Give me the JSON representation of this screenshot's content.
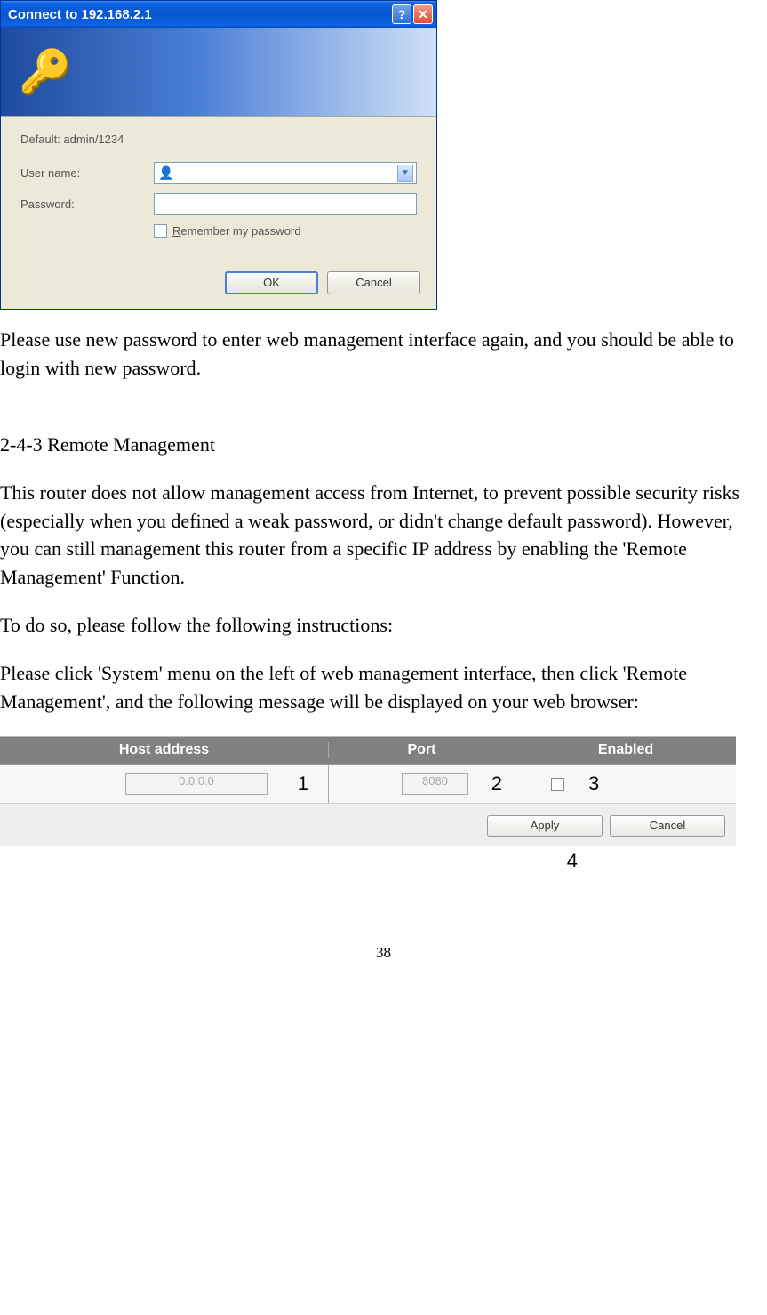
{
  "dialog": {
    "title": "Connect to 192.168.2.1",
    "help_symbol": "?",
    "close_symbol": "✕",
    "default_hint": "Default: admin/1234",
    "username_label": "User name:",
    "password_label": "Password:",
    "remember_prefix": "R",
    "remember_rest": "emember my password",
    "ok_label": "OK",
    "cancel_label": "Cancel"
  },
  "text": {
    "p1": "Please use new password to enter web management interface again, and you should be able to login with new password.",
    "h1": "2-4-3 Remote Management",
    "p2": "This router does not allow management access from Internet, to prevent possible security risks (especially when you defined a weak password, or didn't change default password). However, you can still management this router from a specific IP address by enabling the 'Remote Management' Function.",
    "p3": "To do so, please follow the following instructions:",
    "p4": "Please click 'System' menu on the left of web management interface, then click 'Remote Management', and the following message will be displayed on your web browser:"
  },
  "rm": {
    "headers": {
      "host": "Host address",
      "port": "Port",
      "enabled": "Enabled"
    },
    "host_value": "0.0.0.0",
    "port_value": "8080",
    "apply_label": "Apply",
    "cancel_label": "Cancel"
  },
  "annotations": {
    "a1": "1",
    "a2": "2",
    "a3": "3",
    "a4": "4"
  },
  "page_number": "38"
}
